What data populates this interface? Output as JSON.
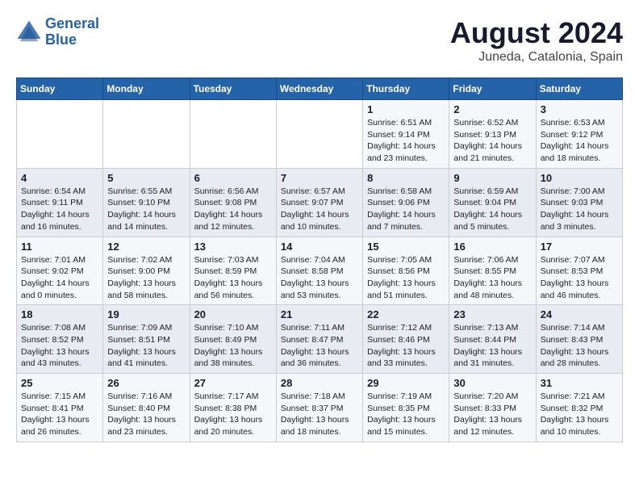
{
  "header": {
    "logo_line1": "General",
    "logo_line2": "Blue",
    "month": "August 2024",
    "location": "Juneda, Catalonia, Spain"
  },
  "weekdays": [
    "Sunday",
    "Monday",
    "Tuesday",
    "Wednesday",
    "Thursday",
    "Friday",
    "Saturday"
  ],
  "weeks": [
    [
      {
        "day": "",
        "info": ""
      },
      {
        "day": "",
        "info": ""
      },
      {
        "day": "",
        "info": ""
      },
      {
        "day": "",
        "info": ""
      },
      {
        "day": "1",
        "info": "Sunrise: 6:51 AM\nSunset: 9:14 PM\nDaylight: 14 hours\nand 23 minutes."
      },
      {
        "day": "2",
        "info": "Sunrise: 6:52 AM\nSunset: 9:13 PM\nDaylight: 14 hours\nand 21 minutes."
      },
      {
        "day": "3",
        "info": "Sunrise: 6:53 AM\nSunset: 9:12 PM\nDaylight: 14 hours\nand 18 minutes."
      }
    ],
    [
      {
        "day": "4",
        "info": "Sunrise: 6:54 AM\nSunset: 9:11 PM\nDaylight: 14 hours\nand 16 minutes."
      },
      {
        "day": "5",
        "info": "Sunrise: 6:55 AM\nSunset: 9:10 PM\nDaylight: 14 hours\nand 14 minutes."
      },
      {
        "day": "6",
        "info": "Sunrise: 6:56 AM\nSunset: 9:08 PM\nDaylight: 14 hours\nand 12 minutes."
      },
      {
        "day": "7",
        "info": "Sunrise: 6:57 AM\nSunset: 9:07 PM\nDaylight: 14 hours\nand 10 minutes."
      },
      {
        "day": "8",
        "info": "Sunrise: 6:58 AM\nSunset: 9:06 PM\nDaylight: 14 hours\nand 7 minutes."
      },
      {
        "day": "9",
        "info": "Sunrise: 6:59 AM\nSunset: 9:04 PM\nDaylight: 14 hours\nand 5 minutes."
      },
      {
        "day": "10",
        "info": "Sunrise: 7:00 AM\nSunset: 9:03 PM\nDaylight: 14 hours\nand 3 minutes."
      }
    ],
    [
      {
        "day": "11",
        "info": "Sunrise: 7:01 AM\nSunset: 9:02 PM\nDaylight: 14 hours\nand 0 minutes."
      },
      {
        "day": "12",
        "info": "Sunrise: 7:02 AM\nSunset: 9:00 PM\nDaylight: 13 hours\nand 58 minutes."
      },
      {
        "day": "13",
        "info": "Sunrise: 7:03 AM\nSunset: 8:59 PM\nDaylight: 13 hours\nand 56 minutes."
      },
      {
        "day": "14",
        "info": "Sunrise: 7:04 AM\nSunset: 8:58 PM\nDaylight: 13 hours\nand 53 minutes."
      },
      {
        "day": "15",
        "info": "Sunrise: 7:05 AM\nSunset: 8:56 PM\nDaylight: 13 hours\nand 51 minutes."
      },
      {
        "day": "16",
        "info": "Sunrise: 7:06 AM\nSunset: 8:55 PM\nDaylight: 13 hours\nand 48 minutes."
      },
      {
        "day": "17",
        "info": "Sunrise: 7:07 AM\nSunset: 8:53 PM\nDaylight: 13 hours\nand 46 minutes."
      }
    ],
    [
      {
        "day": "18",
        "info": "Sunrise: 7:08 AM\nSunset: 8:52 PM\nDaylight: 13 hours\nand 43 minutes."
      },
      {
        "day": "19",
        "info": "Sunrise: 7:09 AM\nSunset: 8:51 PM\nDaylight: 13 hours\nand 41 minutes."
      },
      {
        "day": "20",
        "info": "Sunrise: 7:10 AM\nSunset: 8:49 PM\nDaylight: 13 hours\nand 38 minutes."
      },
      {
        "day": "21",
        "info": "Sunrise: 7:11 AM\nSunset: 8:47 PM\nDaylight: 13 hours\nand 36 minutes."
      },
      {
        "day": "22",
        "info": "Sunrise: 7:12 AM\nSunset: 8:46 PM\nDaylight: 13 hours\nand 33 minutes."
      },
      {
        "day": "23",
        "info": "Sunrise: 7:13 AM\nSunset: 8:44 PM\nDaylight: 13 hours\nand 31 minutes."
      },
      {
        "day": "24",
        "info": "Sunrise: 7:14 AM\nSunset: 8:43 PM\nDaylight: 13 hours\nand 28 minutes."
      }
    ],
    [
      {
        "day": "25",
        "info": "Sunrise: 7:15 AM\nSunset: 8:41 PM\nDaylight: 13 hours\nand 26 minutes."
      },
      {
        "day": "26",
        "info": "Sunrise: 7:16 AM\nSunset: 8:40 PM\nDaylight: 13 hours\nand 23 minutes."
      },
      {
        "day": "27",
        "info": "Sunrise: 7:17 AM\nSunset: 8:38 PM\nDaylight: 13 hours\nand 20 minutes."
      },
      {
        "day": "28",
        "info": "Sunrise: 7:18 AM\nSunset: 8:37 PM\nDaylight: 13 hours\nand 18 minutes."
      },
      {
        "day": "29",
        "info": "Sunrise: 7:19 AM\nSunset: 8:35 PM\nDaylight: 13 hours\nand 15 minutes."
      },
      {
        "day": "30",
        "info": "Sunrise: 7:20 AM\nSunset: 8:33 PM\nDaylight: 13 hours\nand 12 minutes."
      },
      {
        "day": "31",
        "info": "Sunrise: 7:21 AM\nSunset: 8:32 PM\nDaylight: 13 hours\nand 10 minutes."
      }
    ]
  ]
}
